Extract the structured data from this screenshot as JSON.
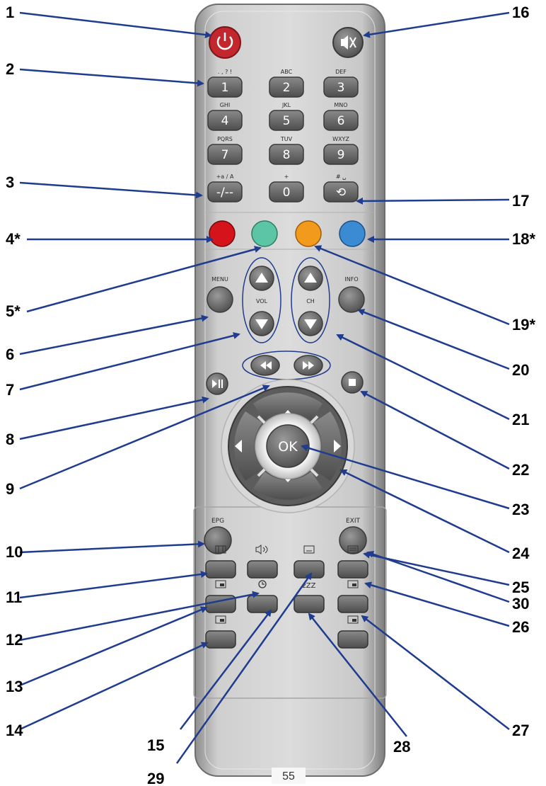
{
  "callouts": [
    "1",
    "2",
    "3",
    "4*",
    "5*",
    "6",
    "7",
    "8",
    "9",
    "10",
    "11",
    "12",
    "13",
    "14",
    "15",
    "16",
    "17",
    "18*",
    "19*",
    "20",
    "21",
    "22",
    "23",
    "24",
    "25",
    "26",
    "27",
    "28",
    "29",
    "30"
  ],
  "keypad": {
    "digits": [
      "1",
      "2",
      "3",
      "4",
      "5",
      "6",
      "7",
      "8",
      "9",
      "-/--",
      "0",
      "⟲"
    ],
    "letters": [
      ". , ? !",
      "ABC",
      "DEF",
      "GHI",
      "JKL",
      "MNO",
      "PQRS",
      "TUV",
      "WXYZ",
      "+a / A",
      "+",
      "# ␣"
    ]
  },
  "labels": {
    "menu": "MENU",
    "vol": "VOL",
    "ch": "CH",
    "info": "INFO",
    "ok": "OK",
    "epg": "EPG",
    "exit": "EXIT",
    "sleep": "zZZ"
  },
  "colors": {
    "red": "#d4131b",
    "green": "#5cc5a5",
    "yellow": "#f29a1b",
    "blue": "#3b8bd3",
    "arrow": "#1f3c8f",
    "body": "#c9c9c9",
    "key": "#6f6f6f"
  },
  "icons": [
    "power-icon",
    "mute-icon",
    "recall-icon",
    "up-arrow-icon",
    "down-arrow-icon",
    "play-pause-icon",
    "rewind-icon",
    "fast-forward-icon",
    "stop-icon",
    "aspect-icon",
    "audio-icon",
    "subtitle-icon",
    "teletext-icon",
    "pip-icon",
    "timer-icon",
    "sleep-icon"
  ],
  "page_number": "55"
}
